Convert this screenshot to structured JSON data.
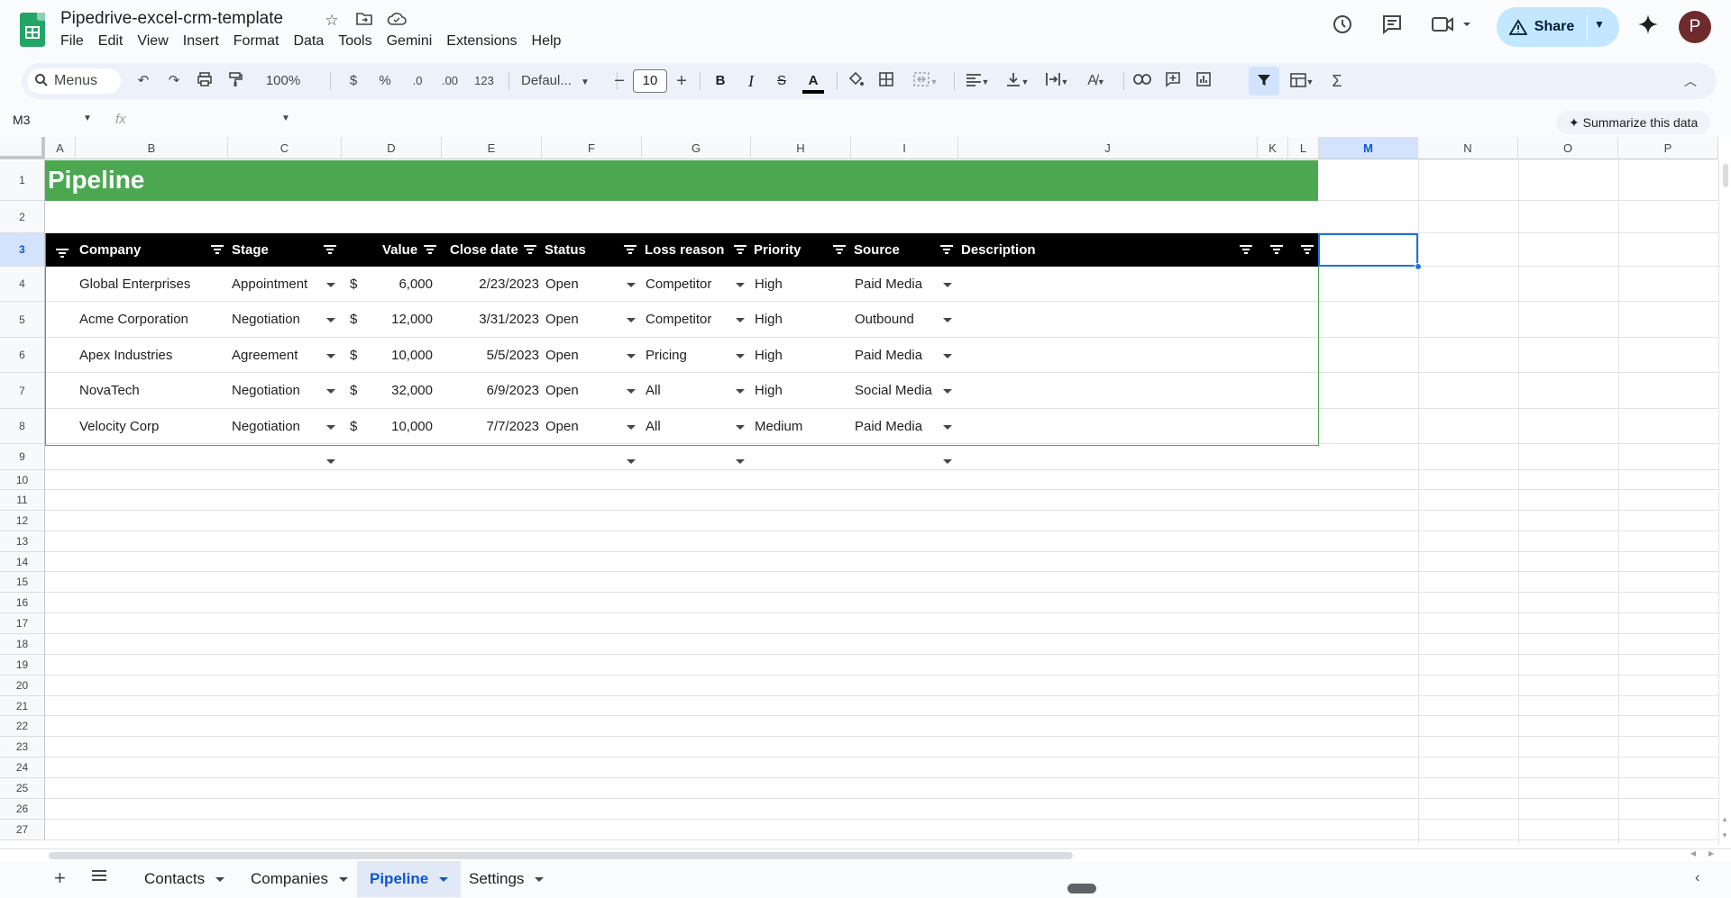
{
  "app": {
    "doc_title": "Pipedrive-excel-crm-template",
    "menu": [
      "File",
      "Edit",
      "View",
      "Insert",
      "Format",
      "Data",
      "Tools",
      "Gemini",
      "Extensions",
      "Help"
    ],
    "share_label": "Share",
    "avatar_letter": "P",
    "brand_color": "#23a566"
  },
  "toolbar": {
    "search_label": "Menus",
    "zoom": "100%",
    "currency": "$",
    "percent": "%",
    "dec_decrease": ".0",
    "dec_increase": ".00",
    "number_format": "123",
    "font_name": "Defaul...",
    "font_size": "10",
    "bold": "B",
    "italic": "I",
    "sigma": "Σ"
  },
  "formula_bar": {
    "cell_ref": "M3",
    "fx": "fx",
    "summarize_label": "Summarize this data"
  },
  "columns": [
    "A",
    "B",
    "C",
    "D",
    "E",
    "F",
    "G",
    "H",
    "I",
    "J",
    "K",
    "L",
    "M",
    "N",
    "O",
    "P"
  ],
  "rows": [
    "1",
    "2",
    "3",
    "4",
    "5",
    "6",
    "7",
    "8",
    "9",
    "10",
    "11",
    "12",
    "13",
    "14",
    "15",
    "16",
    "17",
    "18",
    "19",
    "20",
    "21",
    "22",
    "23",
    "24",
    "25",
    "26",
    "27"
  ],
  "sheet": {
    "title": "Pipeline",
    "headers": {
      "company": "Company",
      "stage": "Stage",
      "value": "Value",
      "close_date": "Close date",
      "status": "Status",
      "loss_reason": "Loss reason",
      "priority": "Priority",
      "source": "Source",
      "description": "Description"
    },
    "records": [
      {
        "company": "Global Enterprises",
        "stage": "Appointment",
        "currency": "$",
        "value": "6,000",
        "close_date": "2/23/2023",
        "status": "Open",
        "loss_reason": "Competitor",
        "priority": "High",
        "source": "Paid Media"
      },
      {
        "company": "Acme Corporation",
        "stage": "Negotiation",
        "currency": "$",
        "value": "12,000",
        "close_date": "3/31/2023",
        "status": "Open",
        "loss_reason": "Competitor",
        "priority": "High",
        "source": "Outbound"
      },
      {
        "company": "Apex Industries",
        "stage": "Agreement",
        "currency": "$",
        "value": "10,000",
        "close_date": "5/5/2023",
        "status": "Open",
        "loss_reason": "Pricing",
        "priority": "High",
        "source": "Paid Media"
      },
      {
        "company": "NovaTech",
        "stage": "Negotiation",
        "currency": "$",
        "value": "32,000",
        "close_date": "6/9/2023",
        "status": "Open",
        "loss_reason": "All",
        "priority": "High",
        "source": "Social Media"
      },
      {
        "company": "Velocity Corp",
        "stage": "Negotiation",
        "currency": "$",
        "value": "10,000",
        "close_date": "7/7/2023",
        "status": "Open",
        "loss_reason": "All",
        "priority": "Medium",
        "source": "Paid Media"
      }
    ],
    "header_color": "#000000",
    "banner_color": "#4ba851"
  },
  "tabs": [
    {
      "label": "Contacts",
      "active": false
    },
    {
      "label": "Companies",
      "active": false
    },
    {
      "label": "Pipeline",
      "active": true
    },
    {
      "label": "Settings",
      "active": false
    }
  ]
}
